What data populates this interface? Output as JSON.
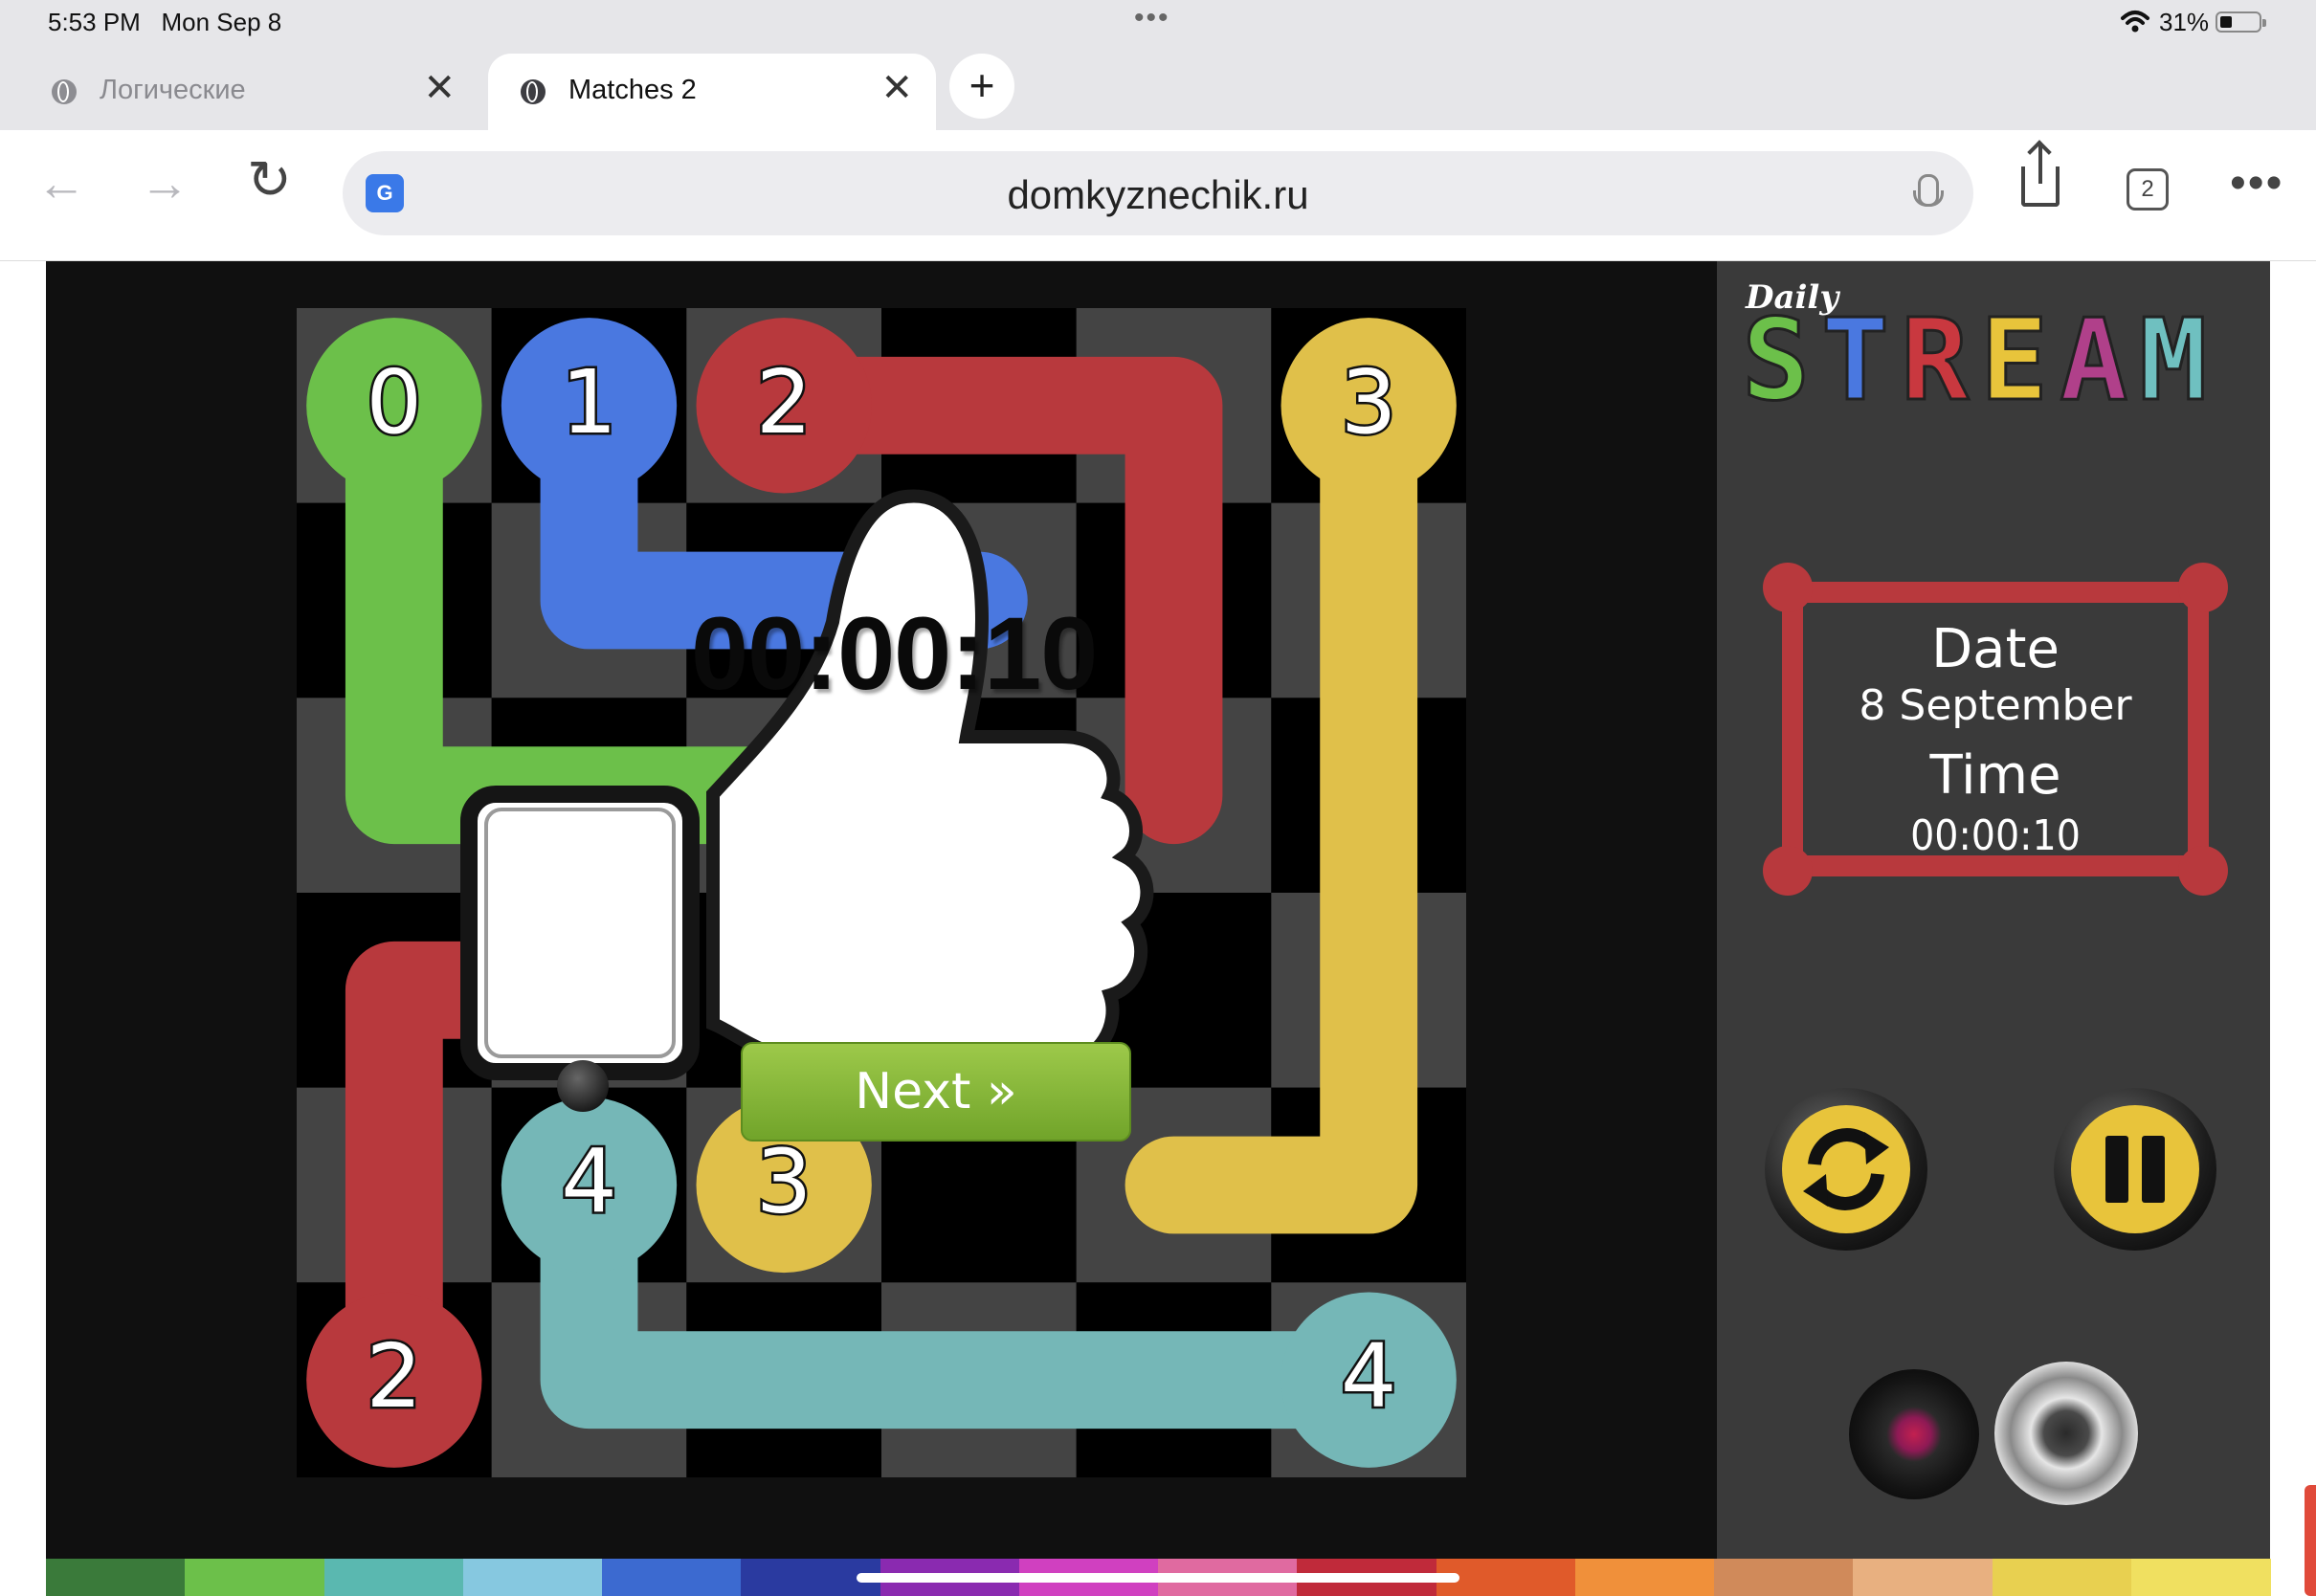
{
  "status_bar": {
    "time": "5:53 PM",
    "date": "Mon Sep 8",
    "battery": "31%"
  },
  "tabs": [
    {
      "title": "Логические"
    },
    {
      "title": "Matches 2"
    }
  ],
  "address": {
    "url": "domkyznechik.ru",
    "tab_count": "2"
  },
  "sidebar": {
    "logo_top": "Daily",
    "logo_letters": [
      {
        "char": "S",
        "color": "#6cc04a"
      },
      {
        "char": "T",
        "color": "#4a78e0"
      },
      {
        "char": "R",
        "color": "#c9383f"
      },
      {
        "char": "E",
        "color": "#e8c43b"
      },
      {
        "char": "A",
        "color": "#b0408a"
      },
      {
        "char": "M",
        "color": "#6fc0c0"
      }
    ],
    "date_label": "Date",
    "date_value": "8 September",
    "time_label": "Time",
    "time_value": "00:00:10"
  },
  "board": {
    "size": 6,
    "colors": {
      "green": "#6cc04a",
      "blue": "#4a78e0",
      "red": "#b8393d",
      "yellow": "#e0c04a",
      "teal": "#75b7b7"
    },
    "endpoints": [
      {
        "row": 0,
        "col": 0,
        "label": "0",
        "color": "green"
      },
      {
        "row": 0,
        "col": 1,
        "label": "1",
        "color": "blue"
      },
      {
        "row": 0,
        "col": 2,
        "label": "2",
        "color": "red"
      },
      {
        "row": 0,
        "col": 5,
        "label": "3",
        "color": "yellow"
      },
      {
        "row": 5,
        "col": 0,
        "label": "2",
        "color": "red"
      },
      {
        "row": 5,
        "col": 5,
        "label": "4",
        "color": "teal"
      },
      {
        "row": 4,
        "col": 1,
        "label": "4",
        "color": "teal"
      },
      {
        "row": 4,
        "col": 2,
        "label": "3",
        "color": "yellow"
      }
    ],
    "paths": [
      {
        "color": "green",
        "cells": [
          [
            0,
            0
          ],
          [
            1,
            0
          ],
          [
            2,
            0
          ],
          [
            2,
            1
          ],
          [
            2,
            2
          ]
        ]
      },
      {
        "color": "blue",
        "cells": [
          [
            0,
            1
          ],
          [
            1,
            1
          ],
          [
            1,
            2
          ],
          [
            1,
            3
          ]
        ]
      },
      {
        "color": "red",
        "cells": [
          [
            0,
            2
          ],
          [
            0,
            3
          ],
          [
            0,
            4
          ],
          [
            1,
            4
          ],
          [
            2,
            4
          ]
        ]
      },
      {
        "color": "red",
        "cells": [
          [
            5,
            0
          ],
          [
            4,
            0
          ],
          [
            3,
            0
          ],
          [
            3,
            1
          ]
        ]
      },
      {
        "color": "yellow",
        "cells": [
          [
            0,
            5
          ],
          [
            1,
            5
          ],
          [
            2,
            5
          ],
          [
            3,
            5
          ],
          [
            4,
            5
          ],
          [
            4,
            4
          ]
        ]
      },
      {
        "color": "teal",
        "cells": [
          [
            4,
            1
          ],
          [
            5,
            1
          ],
          [
            5,
            2
          ],
          [
            5,
            3
          ],
          [
            5,
            4
          ],
          [
            5,
            5
          ]
        ]
      }
    ]
  },
  "popup": {
    "time": "00:00:10",
    "next_label": "Next »"
  },
  "rainbow": [
    "#3a7a3a",
    "#6cc04a",
    "#5ab8b0",
    "#86c8e0",
    "#3c6ad0",
    "#2a3aa0",
    "#8a2ab0",
    "#d040c0",
    "#e06aa0",
    "#c02a3a",
    "#e05a2a",
    "#f0903a",
    "#d08a5a",
    "#e8b080",
    "#e8d050",
    "#f0e060"
  ]
}
